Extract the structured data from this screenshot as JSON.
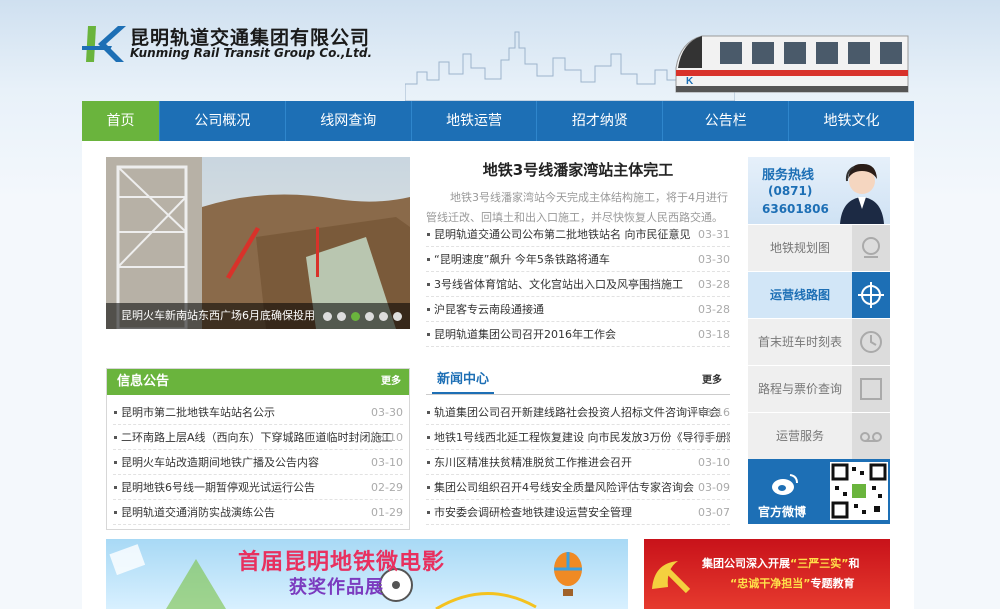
{
  "header": {
    "company_cn": "昆明轨道交通集团有限公司",
    "company_en": "Kunming Rail Transit Group Co.,Ltd."
  },
  "nav": {
    "items": [
      "首页",
      "公司概况",
      "线网查询",
      "地铁运营",
      "招才纳贤",
      "公告栏",
      "地铁文化"
    ]
  },
  "slider": {
    "caption": "昆明火车新南站东西广场6月底确保投用",
    "dot_count": 6,
    "active_dot": 3
  },
  "headline": {
    "title": "地铁3号线潘家湾站主体完工",
    "desc": "地铁3号线潘家湾站今天完成主体结构施工，将于4月进行管线迁改、回填土和出入口施工，并尽快恢复人民西路交通。"
  },
  "top_news": [
    {
      "title": "昆明轨道交通公司公布第二批地铁站名 向市民征意见",
      "date": "03-31"
    },
    {
      "title": "“昆明速度”飙升 今年5条铁路将通车",
      "date": "03-30"
    },
    {
      "title": "3号线省体育馆站、文化宫站出入口及风亭围挡施工",
      "date": "03-28"
    },
    {
      "title": "沪昆客专云南段通接通",
      "date": "03-28"
    },
    {
      "title": "昆明轨道集团公司召开2016年工作会",
      "date": "03-18"
    }
  ],
  "info_panel": {
    "title": "信息公告",
    "more": "更多",
    "items": [
      {
        "title": "昆明市第二批地铁车站站名公示",
        "date": "03-30"
      },
      {
        "title": "二环南路上层A线（西向东）下穿城路匝道临时封闭施工",
        "date": "03-10"
      },
      {
        "title": "昆明火车站改造期间地铁广播及公告内容",
        "date": "03-10"
      },
      {
        "title": "昆明地铁6号线一期暂停观光试运行公告",
        "date": "02-29"
      },
      {
        "title": "昆明轨道交通消防实战演练公告",
        "date": "01-29"
      }
    ]
  },
  "news_panel": {
    "title": "新闻中心",
    "more": "更多",
    "items": [
      {
        "title": "轨道集团公司召开新建线路社会投资人招标文件咨询评审会",
        "date": "03-16"
      },
      {
        "title": "地铁1号线西北延工程恢复建设 向市民发放3万份《导行手册》",
        "date": "03-14"
      },
      {
        "title": "东川区精准扶贫精准脱贫工作推进会召开",
        "date": "03-10"
      },
      {
        "title": "集团公司组织召开4号线安全质量风险评估专家咨询会",
        "date": "03-09"
      },
      {
        "title": "市安委会调研检查地铁建设运营安全管理",
        "date": "03-07"
      }
    ]
  },
  "sidebar": {
    "hotline_label": "服务热线",
    "hotline_area": "(0871)",
    "hotline_number": "63601806",
    "items": [
      {
        "label": "地铁规划图",
        "icon": "map-pin-icon"
      },
      {
        "label": "运营线路图",
        "icon": "crosshair-icon"
      },
      {
        "label": "首末班车时刻表",
        "icon": "clock-icon"
      },
      {
        "label": "路程与票价查询",
        "icon": "square-icon"
      },
      {
        "label": "运营服务",
        "icon": "tape-icon"
      }
    ],
    "weibo_label": "官方微博"
  },
  "banners": {
    "film_line1": "首届昆明地铁微电影",
    "film_line2": "获奖作品展",
    "party_line1_a": "集团公司深入开展",
    "party_line1_b": "“三严三实”",
    "party_line1_c": "和",
    "party_line2_a": "“忠诚干净担当”",
    "party_line2_b": "专题教育"
  },
  "colors": {
    "nav_blue": "#1d6fb5",
    "accent_green": "#6ab43d",
    "party_red": "#c8121a"
  }
}
